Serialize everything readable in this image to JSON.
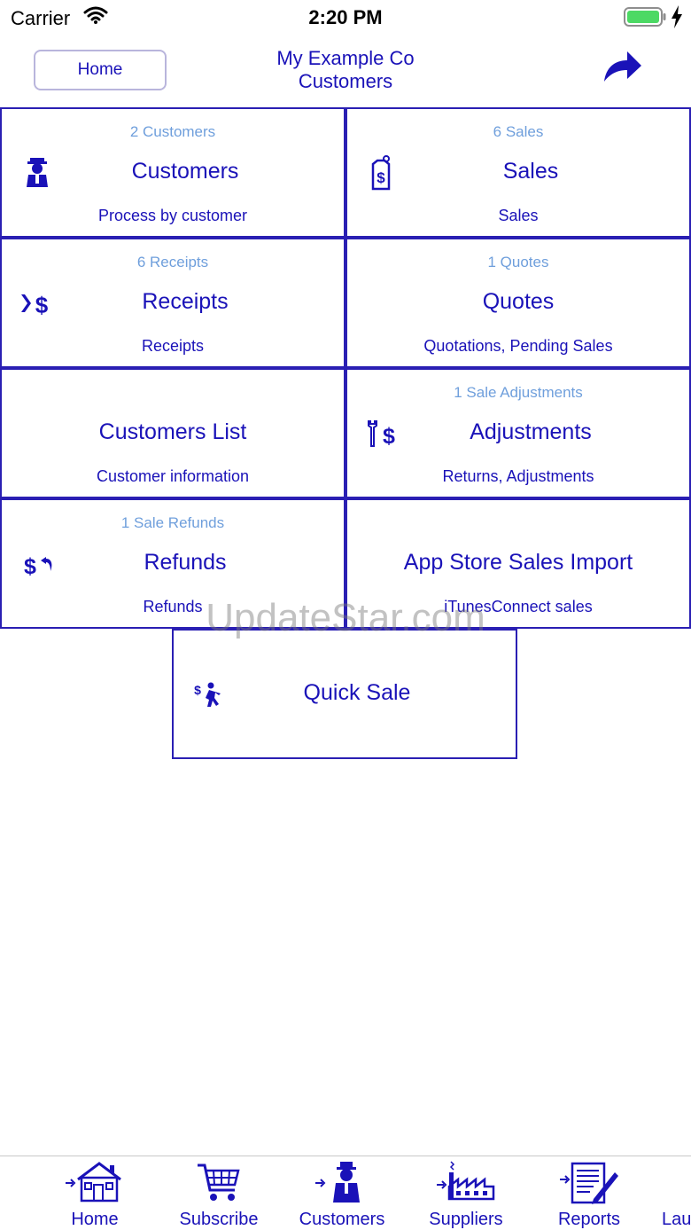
{
  "status_bar": {
    "carrier": "Carrier",
    "time": "2:20 PM"
  },
  "nav": {
    "home_label": "Home",
    "title_line1": "My Example Co",
    "title_line2": "Customers"
  },
  "tiles": [
    {
      "count": "2 Customers",
      "title": "Customers",
      "subtitle": "Process by customer",
      "icon": "customer-icon"
    },
    {
      "count": "6 Sales",
      "title": "Sales",
      "subtitle": "Sales",
      "icon": "price-tag-icon"
    },
    {
      "count": "6 Receipts",
      "title": "Receipts",
      "subtitle": "Receipts",
      "icon": "receipt-dollar-icon"
    },
    {
      "count": "1 Quotes",
      "title": "Quotes",
      "subtitle": "Quotations, Pending Sales",
      "icon": ""
    },
    {
      "count": "",
      "title": "Customers List",
      "subtitle": "Customer information",
      "icon": ""
    },
    {
      "count": "1 Sale Adjustments",
      "title": "Adjustments",
      "subtitle": "Returns, Adjustments",
      "icon": "wrench-dollar-icon"
    },
    {
      "count": "1 Sale Refunds",
      "title": "Refunds",
      "subtitle": "Refunds",
      "icon": "refund-dollar-icon"
    },
    {
      "count": "",
      "title": "App Store Sales Import",
      "subtitle": "iTunesConnect sales",
      "icon": ""
    },
    {
      "count": "",
      "title": "Quick Sale",
      "subtitle": "",
      "icon": "running-dollar-icon"
    }
  ],
  "watermark": "UpdateStar.com",
  "tab_bar": [
    {
      "label": "Home",
      "icon": "house-icon"
    },
    {
      "label": "Subscribe",
      "icon": "cart-icon"
    },
    {
      "label": "Customers",
      "icon": "customer-icon"
    },
    {
      "label": "Suppliers",
      "icon": "factory-icon"
    },
    {
      "label": "Reports",
      "icon": "report-icon"
    },
    {
      "label": "Lau",
      "icon": ""
    }
  ],
  "colors": {
    "accent": "#1a12b8",
    "count_text": "#6f9fdc",
    "tile_border": "#2a1fb3",
    "battery_green": "#4cd964"
  }
}
